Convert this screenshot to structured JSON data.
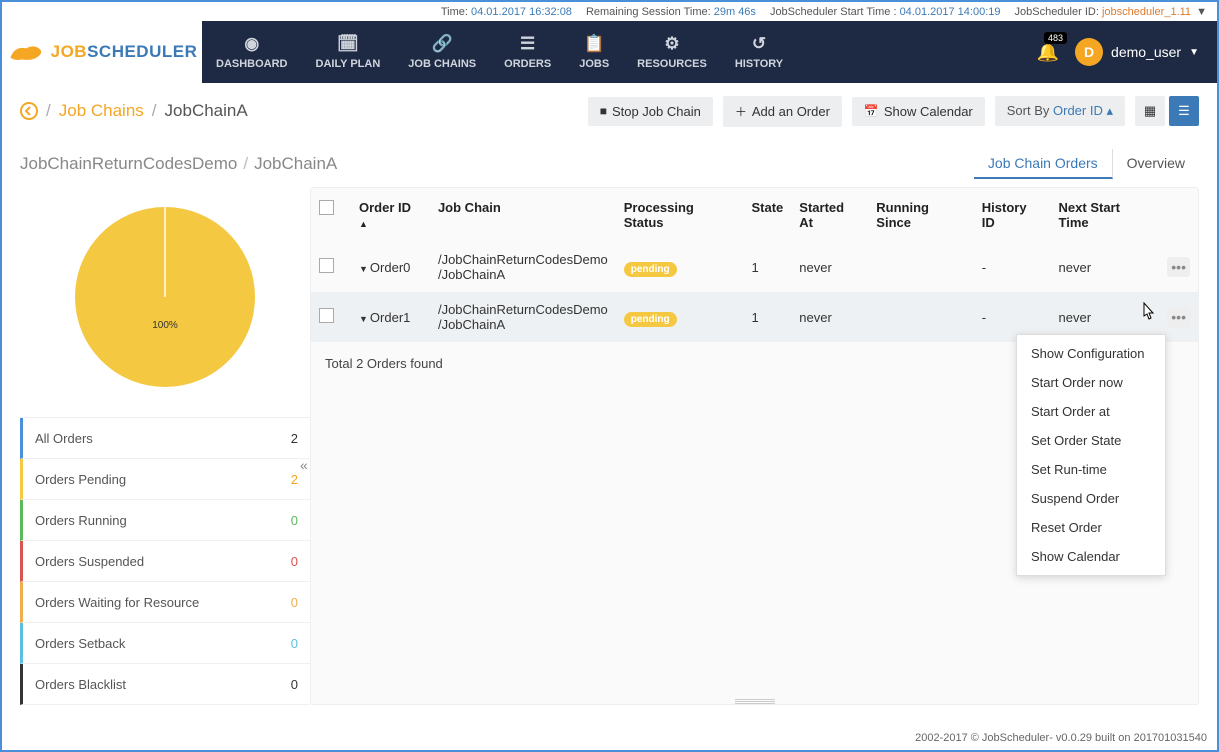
{
  "status_bar": {
    "time_label": "Time:",
    "time_value": "04.01.2017 16:32:08",
    "session_label": "Remaining Session Time:",
    "session_value": "29m 46s",
    "start_label": "JobScheduler Start Time :",
    "start_value": "04.01.2017 14:00:19",
    "id_label": "JobScheduler ID:",
    "id_value": "jobscheduler_1.11"
  },
  "nav": {
    "items": [
      "DASHBOARD",
      "DAILY PLAN",
      "JOB CHAINS",
      "ORDERS",
      "JOBS",
      "RESOURCES",
      "HISTORY"
    ],
    "badge": "483",
    "user_initial": "D",
    "user_name": "demo_user"
  },
  "toolbar": {
    "bc_link": "Job Chains",
    "bc_current": "JobChainA",
    "stop": "Stop Job Chain",
    "add": "Add an Order",
    "calendar": "Show Calendar",
    "sort_label": "Sort By",
    "sort_value": "Order ID"
  },
  "subcrumb": {
    "a": "JobChainReturnCodesDemo",
    "b": "JobChainA"
  },
  "subtabs": {
    "orders": "Job Chain Orders",
    "overview": "Overview"
  },
  "chart_data": {
    "type": "pie",
    "categories": [
      "Orders Pending"
    ],
    "values": [
      2
    ],
    "percent_label": "100%"
  },
  "status_list": [
    {
      "cls": "sr-all",
      "label": "All Orders",
      "count": "2"
    },
    {
      "cls": "sr-pending",
      "label": "Orders Pending",
      "count": "2"
    },
    {
      "cls": "sr-running",
      "label": "Orders Running",
      "count": "0"
    },
    {
      "cls": "sr-suspended",
      "label": "Orders Suspended",
      "count": "0"
    },
    {
      "cls": "sr-waiting",
      "label": "Orders Waiting for Resource",
      "count": "0"
    },
    {
      "cls": "sr-setback",
      "label": "Orders Setback",
      "count": "0"
    },
    {
      "cls": "sr-blacklist",
      "label": "Orders Blacklist",
      "count": "0"
    }
  ],
  "table": {
    "headers": {
      "order_id": "Order ID",
      "job_chain": "Job Chain",
      "processing": "Processing Status",
      "state": "State",
      "started": "Started At",
      "running": "Running Since",
      "history": "History ID",
      "next": "Next Start Time"
    },
    "rows": [
      {
        "order_id": "Order0",
        "job_chain": "/JobChainReturnCodesDemo/JobChainA",
        "status": "pending",
        "state": "1",
        "started": "never",
        "running": "",
        "history": "-",
        "next": "never"
      },
      {
        "order_id": "Order1",
        "job_chain": "/JobChainReturnCodesDemo/JobChainA",
        "status": "pending",
        "state": "1",
        "started": "never",
        "running": "",
        "history": "-",
        "next": "never"
      }
    ],
    "total_line": "Total 2 Orders found"
  },
  "ctx_menu": [
    "Show Configuration",
    "Start Order now",
    "Start Order at",
    "Set Order State",
    "Set Run-time",
    "Suspend Order",
    "Reset Order",
    "Show Calendar"
  ],
  "footer": "2002-2017 © JobScheduler- v0.0.29 built on 201701031540"
}
